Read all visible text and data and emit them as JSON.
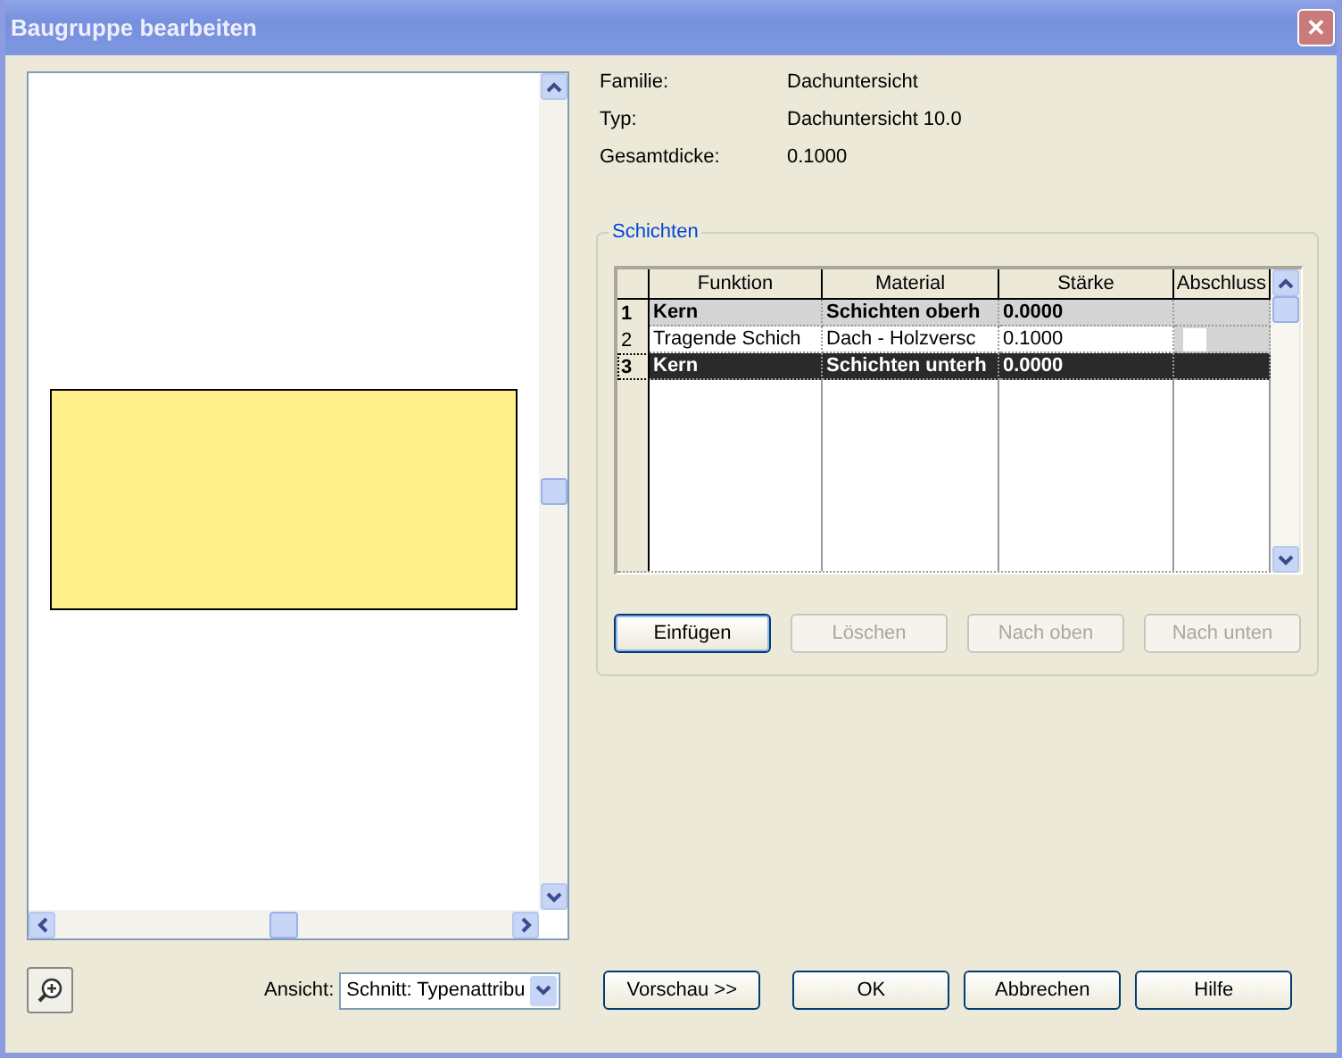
{
  "window": {
    "title": "Baugruppe bearbeiten",
    "close": "✕"
  },
  "info": [
    {
      "label": "Familie:",
      "value": "Dachuntersicht"
    },
    {
      "label": "Typ:",
      "value": "Dachuntersicht 10.0"
    },
    {
      "label": "Gesamtdicke:",
      "value": "0.1000"
    }
  ],
  "layers": {
    "title": "Schichten",
    "columns": [
      "Funktion",
      "Material",
      "Stärke",
      "Abschluss"
    ],
    "rows": [
      {
        "number": "1",
        "kind": "core",
        "function": "Kern",
        "material": "Schichten oberh",
        "thickness": "0.0000",
        "selected": false
      },
      {
        "number": "2",
        "kind": "layer",
        "function": "Tragende Schich",
        "material": "Dach - Holzversc",
        "thickness": "0.1000",
        "selected": false,
        "checked": false
      },
      {
        "number": "3",
        "kind": "core",
        "function": "Kern",
        "material": "Schichten unterh",
        "thickness": "0.0000",
        "selected": true
      }
    ],
    "buttons": [
      {
        "label": "Einfügen",
        "disabled": false
      },
      {
        "label": "Löschen",
        "disabled": true
      },
      {
        "label": "Nach oben",
        "disabled": true
      },
      {
        "label": "Nach unten",
        "disabled": true
      }
    ]
  },
  "view": {
    "label": "Ansicht:",
    "value": "Schnitt: Typenattribu"
  },
  "preview_button": "Vorschau >>",
  "buttons": [
    {
      "label": "OK"
    },
    {
      "label": "Abbrechen"
    },
    {
      "label": "Hilfe"
    }
  ]
}
